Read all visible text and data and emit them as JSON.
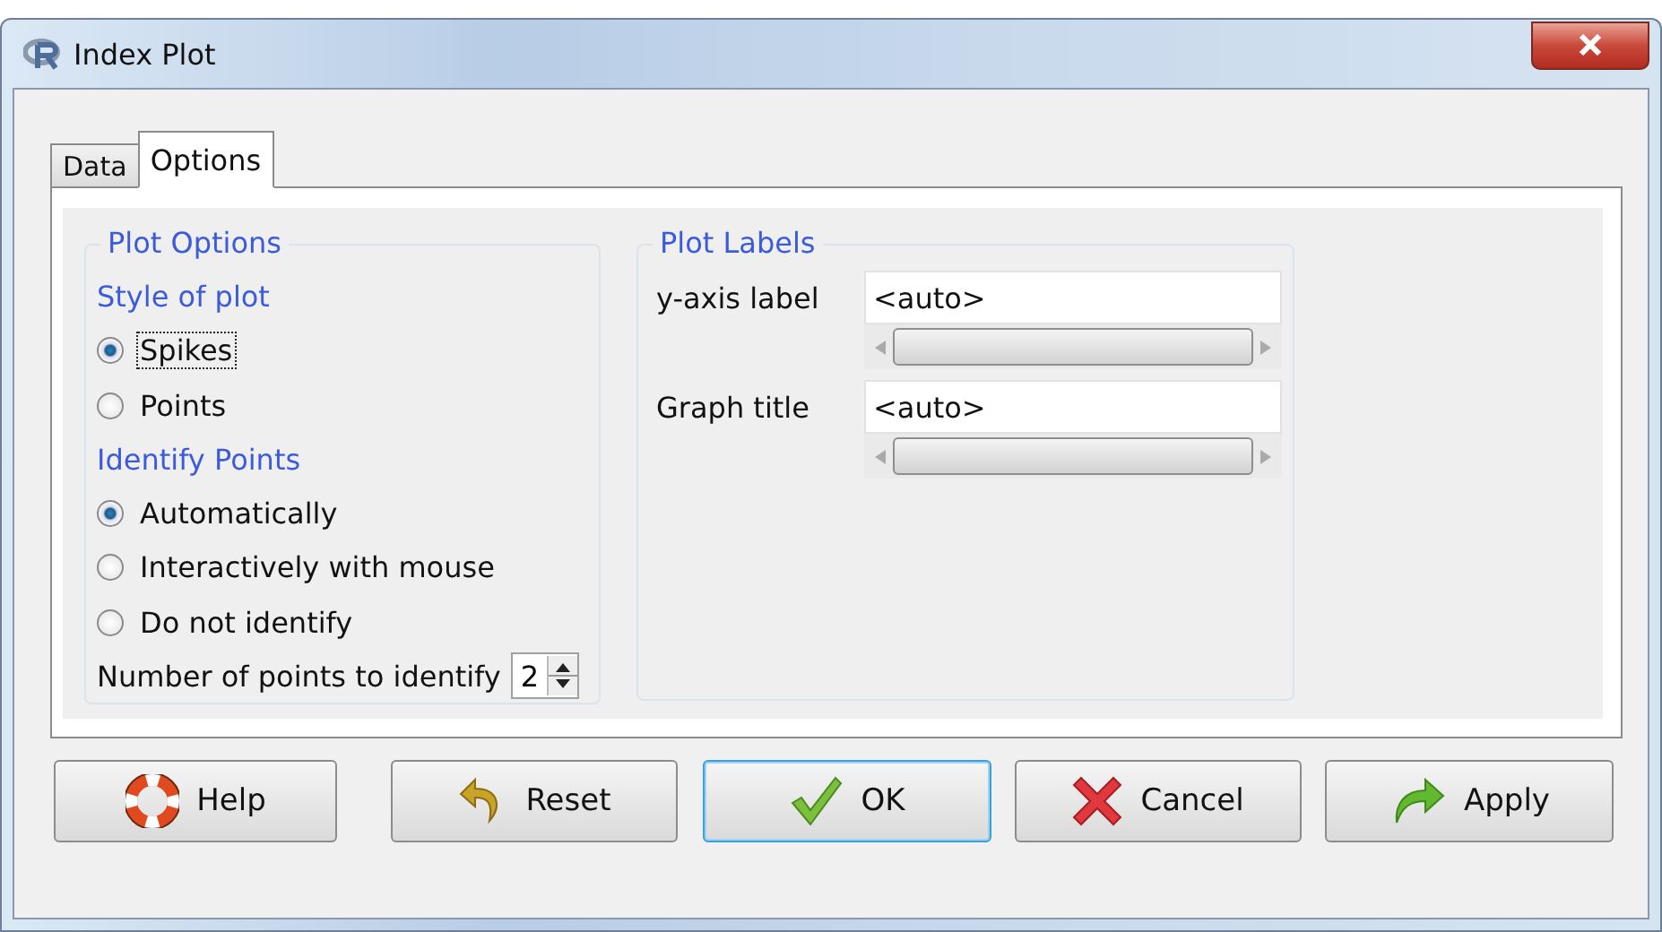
{
  "window": {
    "title": "Index Plot"
  },
  "tabs": [
    {
      "label": "Data",
      "selected": false
    },
    {
      "label": "Options",
      "selected": true
    }
  ],
  "plot_options": {
    "title": "Plot Options",
    "sections": [
      {
        "heading": "Style of plot",
        "options": [
          {
            "label": "Spikes",
            "selected": true,
            "focused": true
          },
          {
            "label": "Points",
            "selected": false,
            "focused": false
          }
        ]
      },
      {
        "heading": "Identify Points",
        "options": [
          {
            "label": "Automatically",
            "selected": true,
            "focused": false
          },
          {
            "label": "Interactively with mouse",
            "selected": false,
            "focused": false
          },
          {
            "label": "Do not identify",
            "selected": false,
            "focused": false
          }
        ]
      }
    ],
    "count": {
      "label": "Number of points to identify",
      "value": "2"
    }
  },
  "plot_labels": {
    "title": "Plot Labels",
    "fields": [
      {
        "label": "y-axis label",
        "value": "<auto>"
      },
      {
        "label": "Graph title",
        "value": "<auto>"
      }
    ]
  },
  "buttons": [
    {
      "label": "Help",
      "kind": "help",
      "default": false
    },
    {
      "label": "Reset",
      "kind": "reset",
      "default": false
    },
    {
      "label": "OK",
      "kind": "ok",
      "default": true
    },
    {
      "label": "Cancel",
      "kind": "cancel",
      "default": false
    },
    {
      "label": "Apply",
      "kind": "apply",
      "default": false
    }
  ]
}
